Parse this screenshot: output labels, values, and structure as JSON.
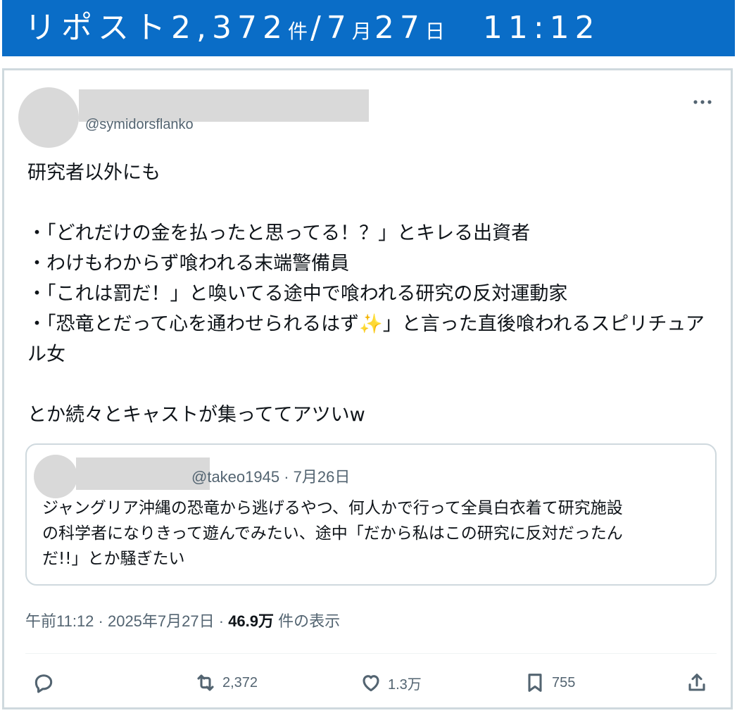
{
  "banner": {
    "repost_label": "リポスト",
    "repost_count": "2,372",
    "count_unit": "件",
    "separator": "/",
    "month": "7",
    "month_unit": "月",
    "day": "27",
    "day_unit": "日",
    "time": "11:12"
  },
  "post": {
    "handle": "@symidorsflanko",
    "body_lines": [
      "研究者以外にも",
      "",
      "・「どれだけの金を払ったと思ってる！？」とキレる出資者",
      "・わけもわからず喰われる末端警備員",
      "・「これは罰だ！」と喚いてる途中で喰われる研究の反対運動家",
      "・「恐竜とだって心を通わせられるはず✨」と言った直後喰われるスピリチュアル女",
      "",
      "とか続々とキャストが集っててアツいw"
    ],
    "quote": {
      "handle": "@takeo1945",
      "date": "7月26日",
      "text_lines": [
        "ジャングリア沖縄の恐竜から逃げるやつ、何人かで行って全員白衣着て研究施設",
        "の科学者になりきって遊んでみたい、途中「だから私はこの研究に反対だったん",
        "だ!!」とか騒ぎたい"
      ]
    },
    "timestamp": "午前11:12 · 2025年7月27日 ·",
    "views_count": "46.9万",
    "views_label": "件の表示",
    "actions": {
      "reply_icon": "reply-icon",
      "retweet_icon": "retweet-icon",
      "retweet_count": "2,372",
      "like_icon": "heart-icon",
      "like_count": "1.3万",
      "bookmark_icon": "bookmark-icon",
      "bookmark_count": "755",
      "share_icon": "share-icon"
    },
    "more_icon": "more-icon"
  },
  "colors": {
    "banner_bg": "#0a6dc7",
    "muted_text": "#536471",
    "border": "#cfd9de"
  }
}
